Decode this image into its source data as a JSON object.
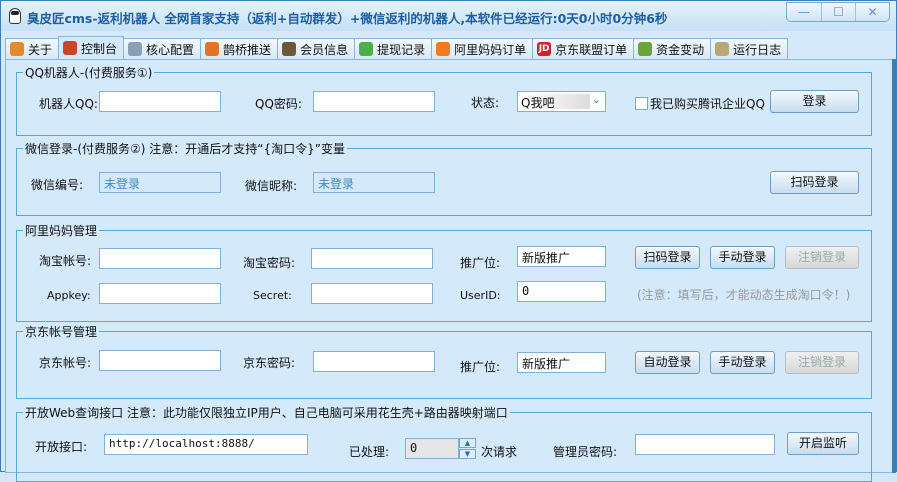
{
  "window": {
    "title": "臭皮匠cms-返利机器人 全网首家支持（返利+自动群发）+微信返利的机器人,本软件已经运行:0天0小时0分钟6秒",
    "minimize": "—",
    "maximize": "☐",
    "close": "✕"
  },
  "tabs": [
    {
      "label": "关于",
      "icon": "home-icon",
      "color": "#e58a2a"
    },
    {
      "label": "控制台",
      "icon": "shield-icon",
      "color": "#c9462a"
    },
    {
      "label": "核心配置",
      "icon": "config-icon",
      "color": "#8aa0b8"
    },
    {
      "label": "鹊桥推送",
      "icon": "clock-icon",
      "color": "#e0742a"
    },
    {
      "label": "会员信息",
      "icon": "user-icon",
      "color": "#6b5a3a"
    },
    {
      "label": "提现记录",
      "icon": "check-icon",
      "color": "#4bb04b"
    },
    {
      "label": "阿里妈妈订单",
      "icon": "alimama-icon",
      "color": "#f07a22"
    },
    {
      "label": "京东联盟订单",
      "icon": "jd-icon",
      "color": "#d4202a"
    },
    {
      "label": "资金变动",
      "icon": "money-icon",
      "color": "#6aa53a"
    },
    {
      "label": "运行日志",
      "icon": "log-icon",
      "color": "#b8a878"
    }
  ],
  "qq": {
    "title": "QQ机器人-(付费服务①)",
    "robot_qq_label": "机器人QQ:",
    "robot_qq": "",
    "pwd_label": "QQ密码:",
    "pwd": "",
    "status_label": "状态:",
    "status": "Q我吧",
    "enterprise_label": "我已购买腾讯企业QQ",
    "login": "登录"
  },
  "wechat": {
    "title": "微信登录-(付费服务②)  注意：开通后才支持“{淘口令}”变量",
    "id_label": "微信编号:",
    "id": "未登录",
    "nick_label": "微信昵称:",
    "nick": "未登录",
    "scan": "扫码登录"
  },
  "alimama": {
    "title": "阿里妈妈管理",
    "account_label": "淘宝帐号:",
    "pwd_label": "淘宝密码:",
    "pid_label": "推广位:",
    "pid": "新版推广",
    "scan": "扫码登录",
    "manual": "手动登录",
    "logout": "注销登录",
    "appkey_label": "Appkey:",
    "secret_label": "Secret:",
    "userid_label": "UserID:",
    "userid": "0",
    "note": "(注意：填写后，才能动态生成淘口令！)"
  },
  "jd": {
    "title": "京东帐号管理",
    "account_label": "京东帐号:",
    "pwd_label": "京东密码:",
    "pid_label": "推广位:",
    "pid": "新版推广",
    "auto": "自动登录",
    "manual": "手动登录",
    "logout": "注销登录"
  },
  "web": {
    "title": "开放Web查询接口 注意：此功能仅限独立IP用户、自己电脑可采用花生壳+路由器映射端口",
    "port_label": "开放接口:",
    "url": "http://localhost:8888/",
    "processed_label": "已处理:",
    "processed": "0",
    "unit": "次请求",
    "admin_label": "管理员密码:",
    "admin": "",
    "listen": "开启监听"
  }
}
